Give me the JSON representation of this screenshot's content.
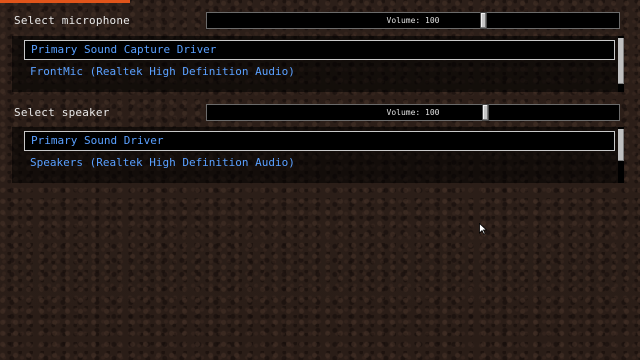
{
  "microphone": {
    "label": "Select microphone",
    "volume_text": "Volume: 100",
    "volume_value": 100,
    "devices": [
      "Primary Sound Capture Driver",
      "FrontMic (Realtek High Definition Audio)"
    ],
    "selected_index": 0
  },
  "speaker": {
    "label": "Select speaker",
    "volume_text": "Volume: 100",
    "volume_value": 100,
    "devices": [
      "Primary Sound Driver",
      "Speakers (Realtek High Definition Audio)"
    ],
    "selected_index": 0
  },
  "colors": {
    "device_text": "#5aa0ff",
    "accent": "#e0541a"
  },
  "icons": {
    "cursor": "mouse-pointer-icon"
  }
}
